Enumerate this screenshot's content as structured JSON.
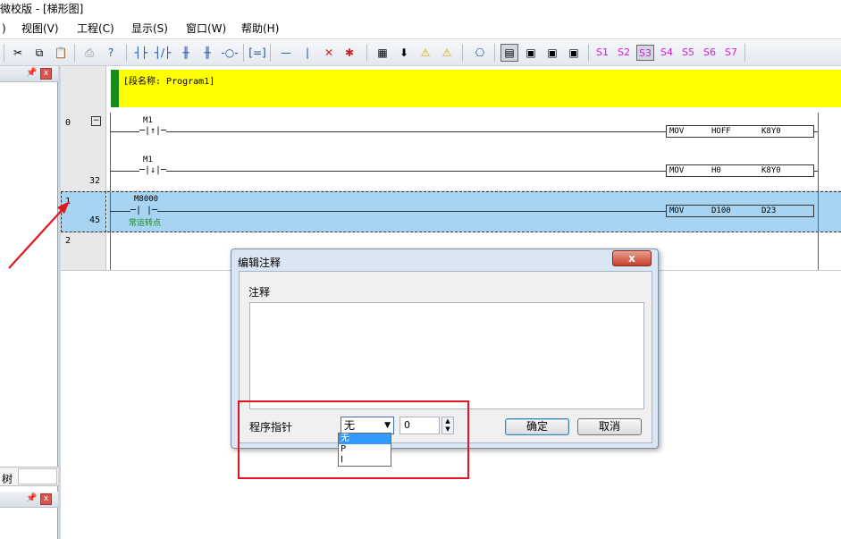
{
  "window": {
    "title": "微校版 - [梯形图]"
  },
  "menubar": {
    "items": [
      "工程(C)",
      "显示(S)",
      "窗口(W)",
      "帮助(H)"
    ],
    "partial_first": ")",
    "view": "视图(V)"
  },
  "toolbar": {
    "s_buttons": [
      "S1",
      "S2",
      "S3",
      "S4",
      "S5",
      "S6",
      "S7"
    ],
    "active_s": "S3"
  },
  "leftpanel": {
    "tree_label": "树"
  },
  "ladder": {
    "segment_header": "[段名称: Program1]",
    "rows": [
      {
        "num": "0",
        "step": "32"
      },
      {
        "num": "1",
        "step": "45"
      },
      {
        "num": "2",
        "step": ""
      }
    ],
    "rungs": [
      {
        "contact_label": "M1",
        "contact_symbol": "─|↑|─",
        "instr": "MOV",
        "op1": "HOFF",
        "op2": "K8Y0"
      },
      {
        "contact_label": "M1",
        "contact_symbol": "─|↓|─",
        "instr": "MOV",
        "op1": "H0",
        "op2": "K8Y0"
      },
      {
        "contact_label": "M8000",
        "contact_symbol": "─| |─",
        "comment": "常运转点",
        "instr": "MOV",
        "op1": "D100",
        "op2": "D23"
      }
    ]
  },
  "dialog": {
    "title": "编辑注释",
    "close": "x",
    "comment_label": "注释",
    "comment_value": "",
    "pointer_label": "程序指针",
    "pointer_selected": "无",
    "pointer_number": "0",
    "pointer_options": [
      "无",
      "P",
      "I"
    ],
    "ok": "确定",
    "cancel": "取消"
  },
  "colors": {
    "segment_bg": "#ffff00",
    "selected_row": "#a6d4f2",
    "annotation": "#e0171f",
    "s_button": "#d020d0"
  }
}
